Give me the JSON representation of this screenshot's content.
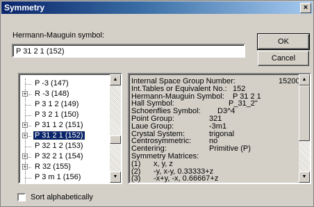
{
  "window": {
    "title": "Symmetry",
    "close_glyph": "×"
  },
  "hm_label": "Hermann-Mauguin symbol:",
  "hm_value": "P 31 2 1 (152)",
  "buttons": {
    "ok": "OK",
    "cancel": "Cancel"
  },
  "tree_items": [
    {
      "label": "P -3 (147)",
      "expand": false,
      "selected": false
    },
    {
      "label": "R -3 (148)",
      "expand": true,
      "selected": false
    },
    {
      "label": "P 3 1 2 (149)",
      "expand": false,
      "selected": false
    },
    {
      "label": "P 3 2 1 (150)",
      "expand": false,
      "selected": false
    },
    {
      "label": "P 31 1 2 (151)",
      "expand": true,
      "selected": false
    },
    {
      "label": "P 31 2 1 (152)",
      "expand": true,
      "selected": true
    },
    {
      "label": "P 32 1 2 (153)",
      "expand": false,
      "selected": false
    },
    {
      "label": "P 32 2 1 (154)",
      "expand": true,
      "selected": false
    },
    {
      "label": "R 32 (155)",
      "expand": true,
      "selected": false
    },
    {
      "label": "P 3 m 1 (156)",
      "expand": false,
      "selected": false
    }
  ],
  "info_rows": [
    {
      "k": "Internal Space Group Number:",
      "v": "15200"
    },
    {
      "k": "Int.Tables or Equivalent No.:",
      "v": "152"
    },
    {
      "k": "Hermann-Mauguin Symbol:",
      "v": "P 31 2 1"
    },
    {
      "k": "Hall Symbol:",
      "v": "P_31_2\""
    },
    {
      "k": "Schoenflies Symbol:",
      "v": "D3^4"
    },
    {
      "k": "Point Group:",
      "v": "321"
    },
    {
      "k": "Laue Group:",
      "v": "-3m1"
    },
    {
      "k": "Crystal System:",
      "v": "trigonal"
    },
    {
      "k": "Centrosymmetric:",
      "v": "no"
    },
    {
      "k": "Centering:",
      "v": "Primitive (P)"
    },
    {
      "k": "Symmetry Matrices:",
      "v": ""
    },
    {
      "k": "(1)",
      "v": "x, y, z"
    },
    {
      "k": "(2)",
      "v": "-y, x-y, 0.33333+z"
    },
    {
      "k": "(3)",
      "v": "-x+y, -x, 0.66667+z"
    }
  ],
  "sort_label": "Sort alphabetically"
}
